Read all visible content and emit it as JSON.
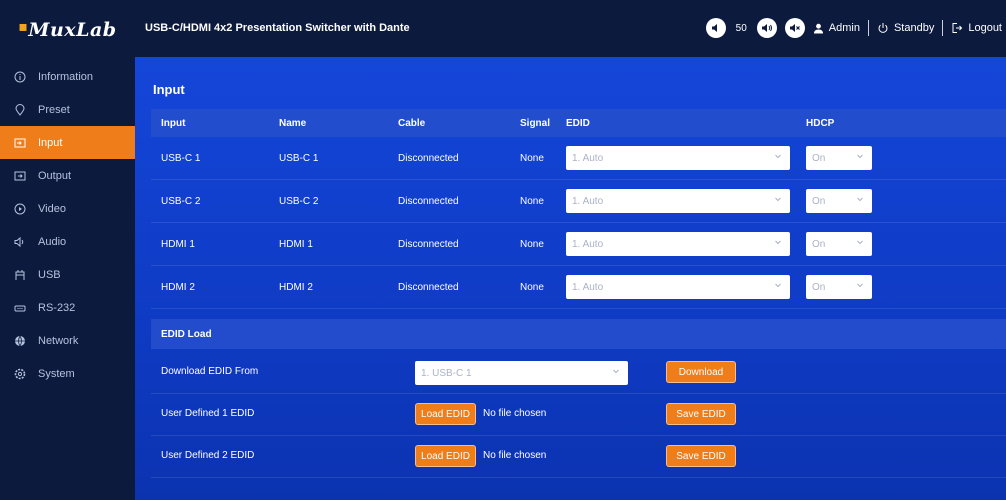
{
  "brand": {
    "logo_text": "MuxLab"
  },
  "header": {
    "title": "USB-C/HDMI 4x2 Presentation Switcher with Dante",
    "volume_value": "50",
    "user_label": "Admin",
    "standby_label": "Standby",
    "logout_label": "Logout"
  },
  "sidebar": {
    "items": [
      {
        "label": "Information",
        "icon": "info-icon"
      },
      {
        "label": "Preset",
        "icon": "location-pin-icon"
      },
      {
        "label": "Input",
        "icon": "input-icon",
        "active": true
      },
      {
        "label": "Output",
        "icon": "output-icon"
      },
      {
        "label": "Video",
        "icon": "video-icon"
      },
      {
        "label": "Audio",
        "icon": "speaker-icon"
      },
      {
        "label": "USB",
        "icon": "usb-icon"
      },
      {
        "label": "RS-232",
        "icon": "serial-port-icon"
      },
      {
        "label": "Network",
        "icon": "globe-icon"
      },
      {
        "label": "System",
        "icon": "gear-icon"
      }
    ]
  },
  "input_section": {
    "title": "Input",
    "columns": [
      "Input",
      "Name",
      "Cable",
      "Signal",
      "EDID",
      "HDCP"
    ],
    "rows": [
      {
        "input": "USB-C 1",
        "name": "USB-C 1",
        "cable": "Disconnected",
        "signal": "None",
        "edid": "1. Auto",
        "hdcp": "On"
      },
      {
        "input": "USB-C 2",
        "name": "USB-C 2",
        "cable": "Disconnected",
        "signal": "None",
        "edid": "1. Auto",
        "hdcp": "On"
      },
      {
        "input": "HDMI 1",
        "name": "HDMI 1",
        "cable": "Disconnected",
        "signal": "None",
        "edid": "1. Auto",
        "hdcp": "On"
      },
      {
        "input": "HDMI 2",
        "name": "HDMI 2",
        "cable": "Disconnected",
        "signal": "None",
        "edid": "1. Auto",
        "hdcp": "On"
      }
    ]
  },
  "edid_load": {
    "title": "EDID Load",
    "download_from_label": "Download EDID From",
    "download_from_value": "1. USB-C 1",
    "download_button": "Download",
    "user1_label": "User Defined 1 EDID",
    "user2_label": "User Defined 2 EDID",
    "load_button": "Load EDID",
    "no_file_text": "No file chosen",
    "save_button": "Save EDID"
  },
  "colors": {
    "sidebar_bg": "#0c1a3e",
    "main_bg": "#1446d9",
    "accent": "#ef7d1a"
  }
}
